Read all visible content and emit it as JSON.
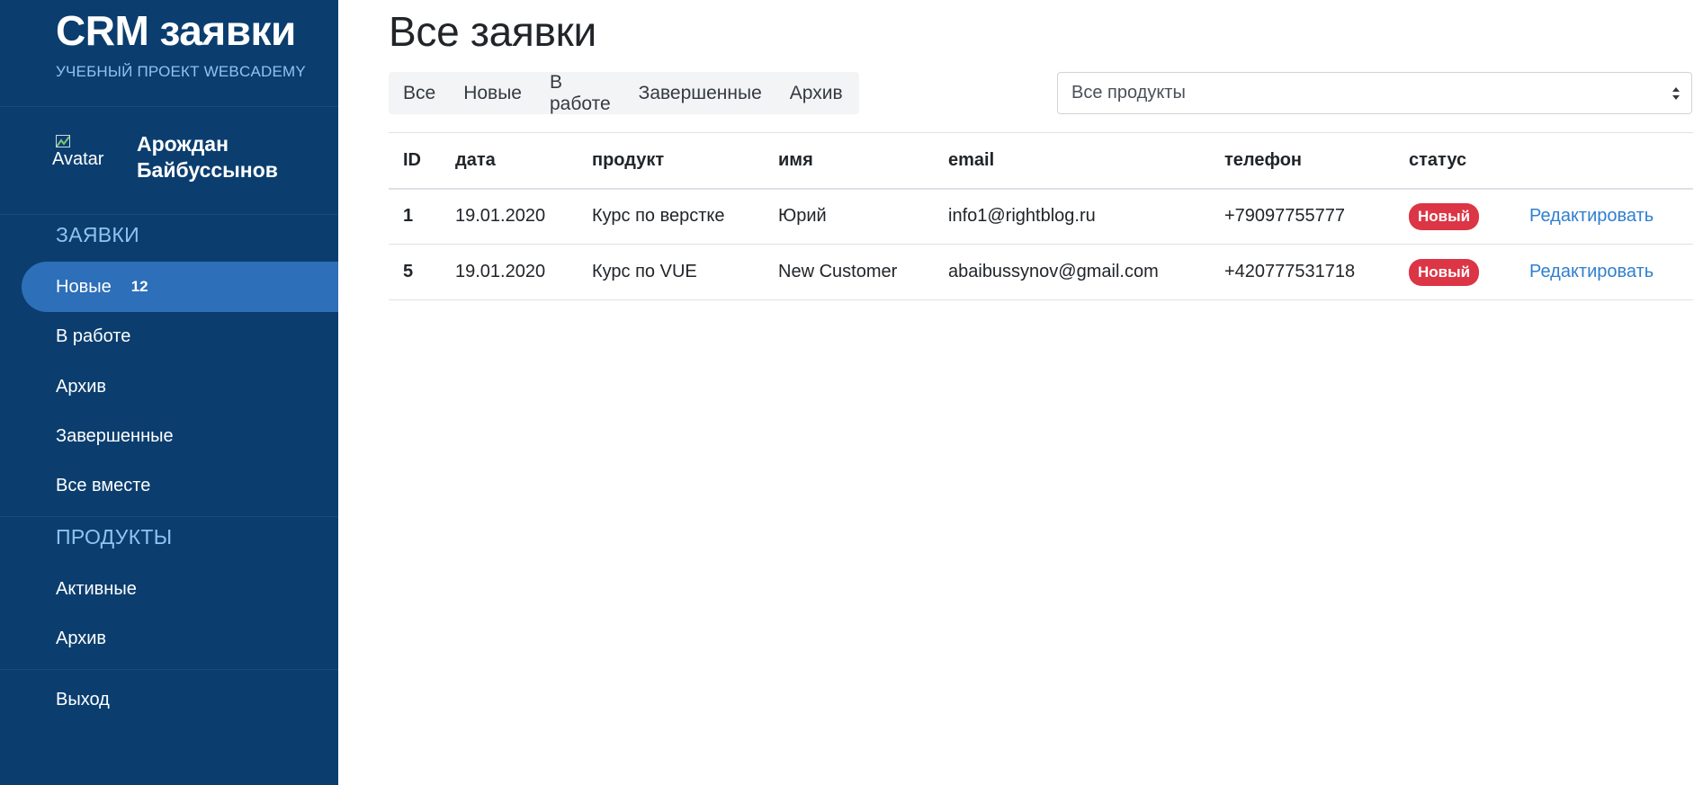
{
  "sidebar": {
    "brand_title": "CRM заявки",
    "brand_subtitle": "УЧЕБНЫЙ ПРОЕКТ WEBCADEMY",
    "user": {
      "avatar_alt": "Avatar",
      "name_line1": "Арождан",
      "name_line2": "Байбуссынов"
    },
    "requests_section": "ЗАЯВКИ",
    "request_items": [
      {
        "label": "Новые",
        "badge": "12",
        "active": true
      },
      {
        "label": "В работе"
      },
      {
        "label": "Архив"
      },
      {
        "label": "Завершенные"
      },
      {
        "label": "Все вместе"
      }
    ],
    "products_section": "ПРОДУКТЫ",
    "product_items": [
      {
        "label": "Активные"
      },
      {
        "label": "Архив"
      }
    ],
    "logout_label": "Выход"
  },
  "main": {
    "title": "Все заявки",
    "filter_tabs": [
      "Все",
      "Новые",
      "В работе",
      "Завершенные",
      "Архив"
    ],
    "product_select": {
      "selected": "Все продукты"
    },
    "table": {
      "headers": [
        "ID",
        "дата",
        "продукт",
        "имя",
        "email",
        "телефон",
        "статус",
        ""
      ],
      "rows": [
        {
          "id": "1",
          "date": "19.01.2020",
          "product": "Курс по верстке",
          "name": "Юрий",
          "email": "info1@rightblog.ru",
          "phone": "+79097755777",
          "status": "Новый",
          "action": "Редактировать"
        },
        {
          "id": "5",
          "date": "19.01.2020",
          "product": "Курс по VUE",
          "name": "New Customer",
          "email": "abaibussynov@gmail.com",
          "phone": "+420777531718",
          "status": "Новый",
          "action": "Редактировать"
        }
      ]
    }
  },
  "colors": {
    "sidebar_bg": "#0b3e6f",
    "active_item": "#2d6fb8",
    "section_title": "#8fc3f0",
    "badge_red": "#dc3545",
    "link_blue": "#2f7fcf"
  }
}
